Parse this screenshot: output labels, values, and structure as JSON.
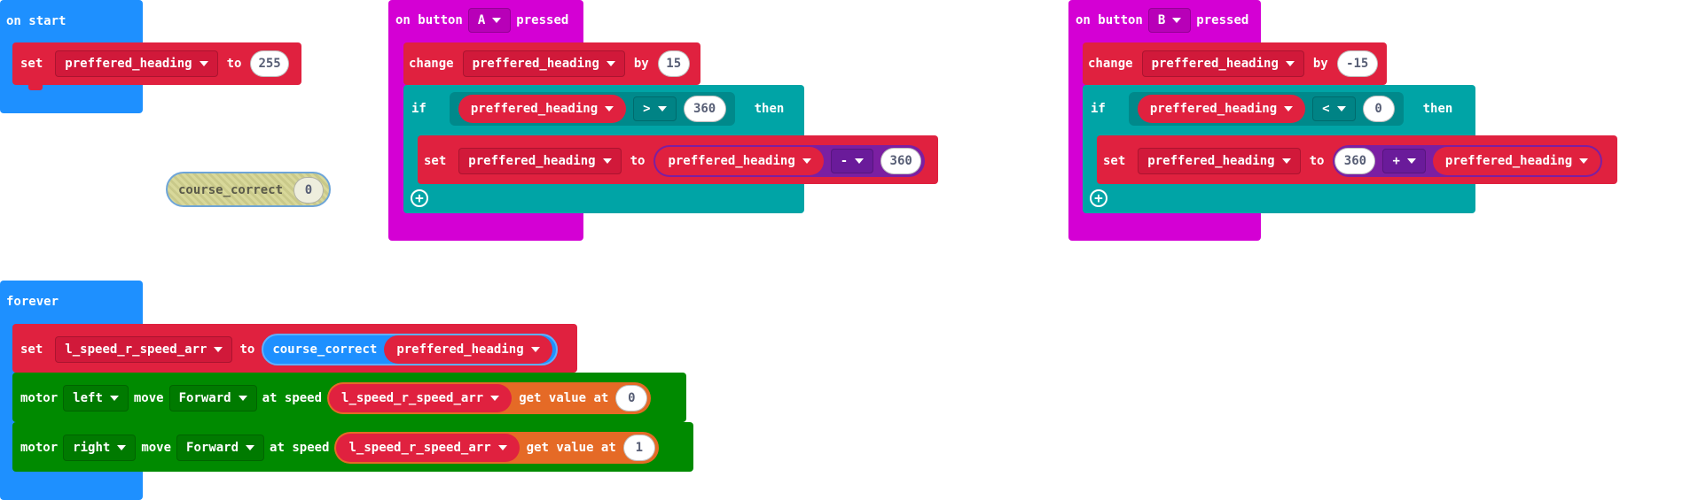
{
  "colors": {
    "basic_blue": "#1E90FF",
    "variables_red": "#E0213F",
    "input_magenta": "#D400D4",
    "logic_teal": "#00A4A6",
    "motors_green": "#008A00",
    "arrays_orange": "#E56A26",
    "math_purple": "#7B1FA2",
    "disabled_yellow": "#D8D89A"
  },
  "on_start": {
    "title": "on start",
    "set": {
      "kw": "set",
      "var": "preffered_heading",
      "to": "to",
      "value": "255"
    }
  },
  "course_correct_block": {
    "name": "course_correct",
    "arg": "0"
  },
  "button_a": {
    "prefix": "on button",
    "button": "A",
    "suffix": "pressed",
    "change": {
      "kw": "change",
      "var": "preffered_heading",
      "by": "by",
      "value": "15"
    },
    "if": {
      "kw": "if",
      "var": "preffered_heading",
      "op": ">",
      "value": "360",
      "then": "then"
    },
    "set": {
      "kw": "set",
      "var": "preffered_heading",
      "to": "to",
      "rhs_var": "preffered_heading",
      "op": "-",
      "value": "360"
    }
  },
  "button_b": {
    "prefix": "on button",
    "button": "B",
    "suffix": "pressed",
    "change": {
      "kw": "change",
      "var": "preffered_heading",
      "by": "by",
      "value": "-15"
    },
    "if": {
      "kw": "if",
      "var": "preffered_heading",
      "op": "<",
      "value": "0",
      "then": "then"
    },
    "set": {
      "kw": "set",
      "var": "preffered_heading",
      "to": "to",
      "value": "360",
      "op": "+",
      "rhs_var": "preffered_heading"
    }
  },
  "forever": {
    "title": "forever",
    "set": {
      "kw": "set",
      "var": "l_speed_r_speed_arr",
      "to": "to",
      "fn": "course_correct",
      "arg_var": "preffered_heading"
    },
    "motor1": {
      "kw": "motor",
      "side": "left",
      "move": "move",
      "dir": "Forward",
      "at_speed": "at speed",
      "arr": "l_speed_r_speed_arr",
      "get": "get value at",
      "index": "0"
    },
    "motor2": {
      "kw": "motor",
      "side": "right",
      "move": "move",
      "dir": "Forward",
      "at_speed": "at speed",
      "arr": "l_speed_r_speed_arr",
      "get": "get value at",
      "index": "1"
    }
  }
}
